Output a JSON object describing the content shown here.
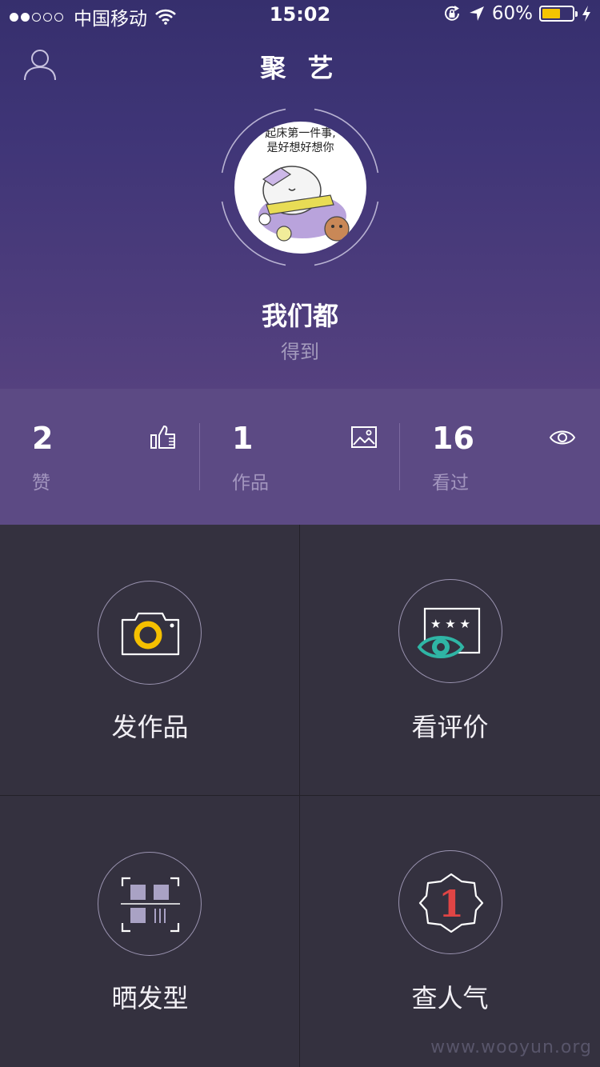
{
  "status_bar": {
    "carrier": "中国移动",
    "time": "15:02",
    "battery_percent": "60%",
    "battery_level": 0.6,
    "battery_color": "#f5c400"
  },
  "nav": {
    "title": "聚 艺",
    "user_icon": "user-icon"
  },
  "profile": {
    "avatar_caption_line1": "起床第一件事,",
    "avatar_caption_line2": "是好想好想你",
    "name": "我们都",
    "subtitle": "得到"
  },
  "stats": [
    {
      "value": "2",
      "label": "赞",
      "icon": "thumbs-up-icon"
    },
    {
      "value": "1",
      "label": "作品",
      "icon": "image-icon"
    },
    {
      "value": "16",
      "label": "看过",
      "icon": "eye-icon"
    }
  ],
  "actions": [
    {
      "label": "发作品",
      "icon": "camera-icon",
      "accent": "#f5c000"
    },
    {
      "label": "看评价",
      "icon": "rating-eye-icon",
      "accent": "#2fb5a5"
    },
    {
      "label": "晒发型",
      "icon": "scan-icon",
      "accent": "#a9a2c4"
    },
    {
      "label": "查人气",
      "icon": "ranking-badge-icon",
      "accent": "#e04545"
    }
  ],
  "watermark": "www.wooyun.org"
}
